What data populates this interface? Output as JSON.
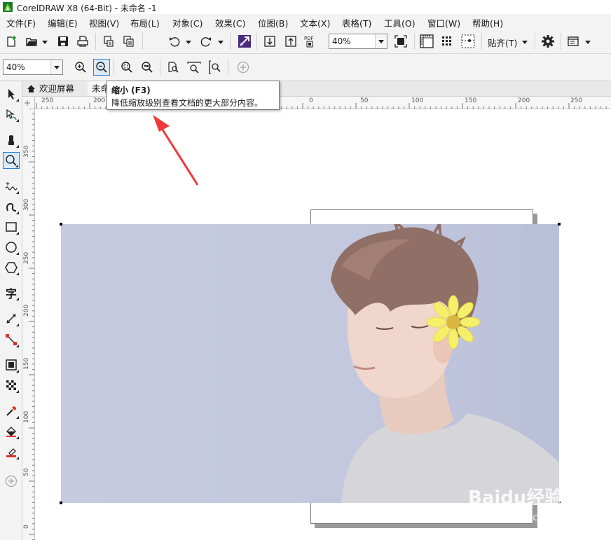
{
  "window": {
    "title": "CorelDRAW X8 (64-Bit) - 未命名 -1"
  },
  "menu": {
    "items": [
      "文件(F)",
      "编辑(E)",
      "视图(V)",
      "布局(L)",
      "对象(C)",
      "效果(C)",
      "位图(B)",
      "文本(X)",
      "表格(T)",
      "工具(O)",
      "窗口(W)",
      "帮助(H)"
    ]
  },
  "toolbar": {
    "zoom_value": "40%",
    "snap_label": "贴齐(T)",
    "icons": [
      "new-document-icon",
      "open-icon",
      "save-icon",
      "print-icon",
      "cut-icon",
      "copy-icon",
      "undo-icon",
      "redo-icon",
      "corel-connect-icon",
      "import-icon",
      "export-icon",
      "publish-pdf-icon",
      "full-screen-icon",
      "rulers-icon",
      "grid-icon",
      "guidelines-icon",
      "settings-icon",
      "application-launcher-icon"
    ]
  },
  "property_bar": {
    "zoom_value": "40%",
    "icons": [
      "zoom-in-icon",
      "zoom-out-icon",
      "zoom-to-selected-icon",
      "zoom-to-all-objects-icon",
      "zoom-to-page-icon",
      "zoom-to-page-width-icon",
      "zoom-to-page-height-icon",
      "add-icon"
    ]
  },
  "toolbox": {
    "icons": [
      "pick-tool-icon",
      "shape-tool-icon",
      "crop-tool-icon",
      "zoom-tool-icon",
      "freehand-tool-icon",
      "artistic-media-tool-icon",
      "rectangle-tool-icon",
      "ellipse-tool-icon",
      "polygon-tool-icon",
      "text-tool-icon",
      "parallel-dimension-tool-icon",
      "connector-tool-icon",
      "drop-shadow-tool-icon",
      "transparency-tool-icon",
      "eyedropper-tool-icon",
      "interactive-fill-tool-icon",
      "smart-fill-tool-icon",
      "add-tool-icon"
    ],
    "text_tool_glyph": "字"
  },
  "doc_tabs": {
    "welcome": "欢迎屏幕",
    "document": "未命名"
  },
  "ruler": {
    "top_ticks": [
      "250",
      "200",
      "0",
      "50",
      "100",
      "150",
      "200",
      "250"
    ],
    "left_ticks": [
      "350",
      "300",
      "250",
      "200",
      "150",
      "100",
      "50",
      "0"
    ]
  },
  "tooltip": {
    "title": "缩小 (F3)",
    "description": "降低缩放级别查看文档的更大部分内容。"
  },
  "watermark": {
    "logo": "Baidu经验",
    "url": "jingyan.baidu.com"
  },
  "colors": {
    "annotation_arrow": "#f0393a",
    "photo_background": "#c2c7de"
  }
}
